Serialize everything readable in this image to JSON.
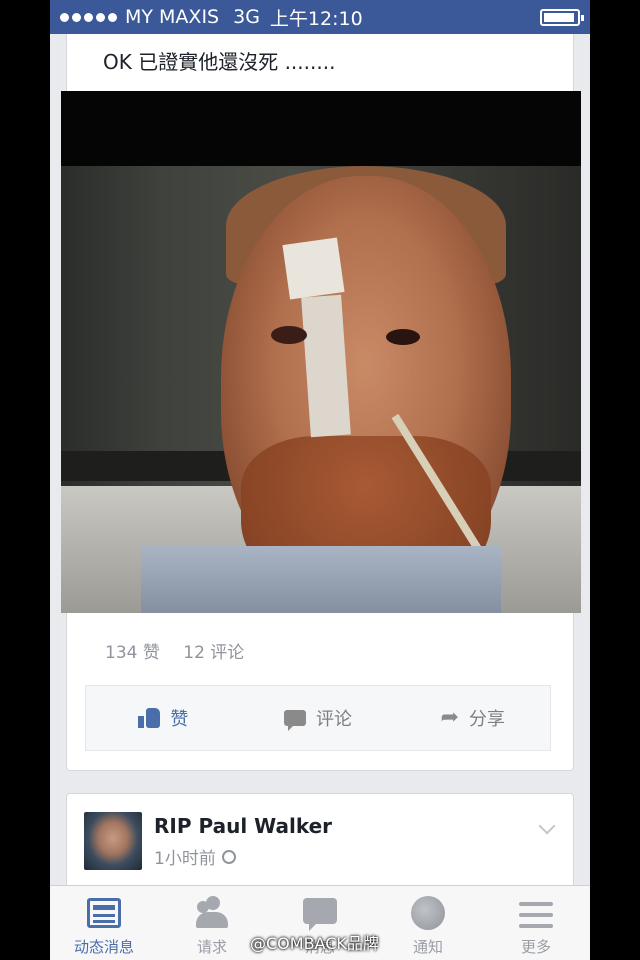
{
  "status_bar": {
    "carrier": "MY MAXIS",
    "network": "3G",
    "time": "上午12:10"
  },
  "post": {
    "text": "OK 已證實他還沒死 ........",
    "likes": "134 赞",
    "comments": "12 评论",
    "actions": {
      "like": "赞",
      "comment": "评论",
      "share": "分享"
    }
  },
  "next_post": {
    "title": "RIP Paul Walker",
    "time": "1小时前"
  },
  "tabs": [
    {
      "label": "动态消息",
      "icon": "news-feed-icon",
      "active": true
    },
    {
      "label": "请求",
      "icon": "friend-requests-icon",
      "active": false
    },
    {
      "label": "消息",
      "icon": "messages-icon",
      "active": false
    },
    {
      "label": "通知",
      "icon": "notifications-icon",
      "active": false
    },
    {
      "label": "更多",
      "icon": "more-icon",
      "active": false
    }
  ],
  "watermark": "@COMBACK品牌",
  "colors": {
    "brand": "#3b5998",
    "active_tab": "#4a6ea9",
    "muted": "#90949c"
  }
}
